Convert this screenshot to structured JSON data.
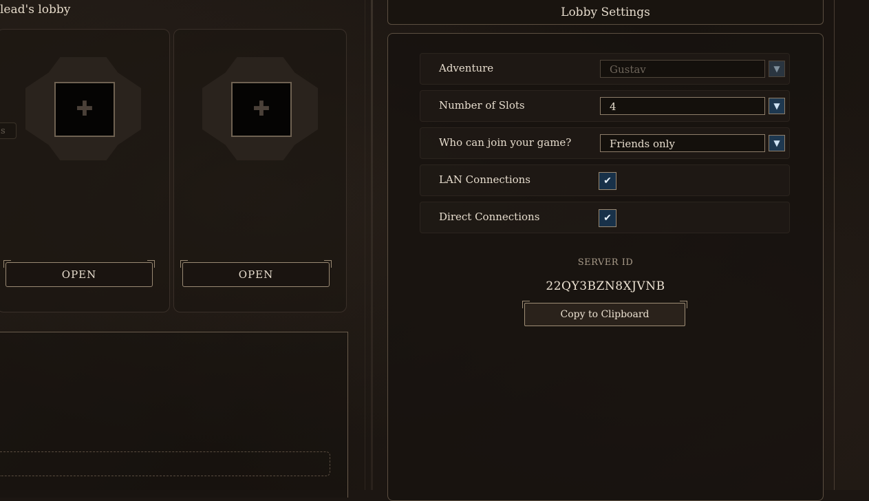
{
  "lobby": {
    "title": "lead's lobby",
    "stub_label": "s",
    "slots": [
      {
        "button_label": "OPEN",
        "portrait_icon": "cross-placeholder-icon"
      },
      {
        "button_label": "OPEN",
        "portrait_icon": "cross-placeholder-icon"
      }
    ]
  },
  "settings": {
    "title": "Lobby Settings",
    "rows": [
      {
        "label": "Adventure",
        "type": "dropdown",
        "value": "Gustav",
        "disabled": true
      },
      {
        "label": "Number of Slots",
        "type": "dropdown",
        "value": "4",
        "disabled": false
      },
      {
        "label": "Who can join your game?",
        "type": "dropdown",
        "value": "Friends only",
        "disabled": false
      },
      {
        "label": "LAN Connections",
        "type": "checkbox",
        "checked": true
      },
      {
        "label": "Direct Connections",
        "type": "checkbox",
        "checked": true
      }
    ],
    "server_id_label": "SERVER ID",
    "server_id_value": "22QY3BZN8XJVNB",
    "copy_button_label": "Copy to Clipboard"
  },
  "colors": {
    "background": "#1c1612",
    "accent_blue": "#1e3850",
    "frame_border": "#9a8a74",
    "text": "#e6dccd"
  }
}
